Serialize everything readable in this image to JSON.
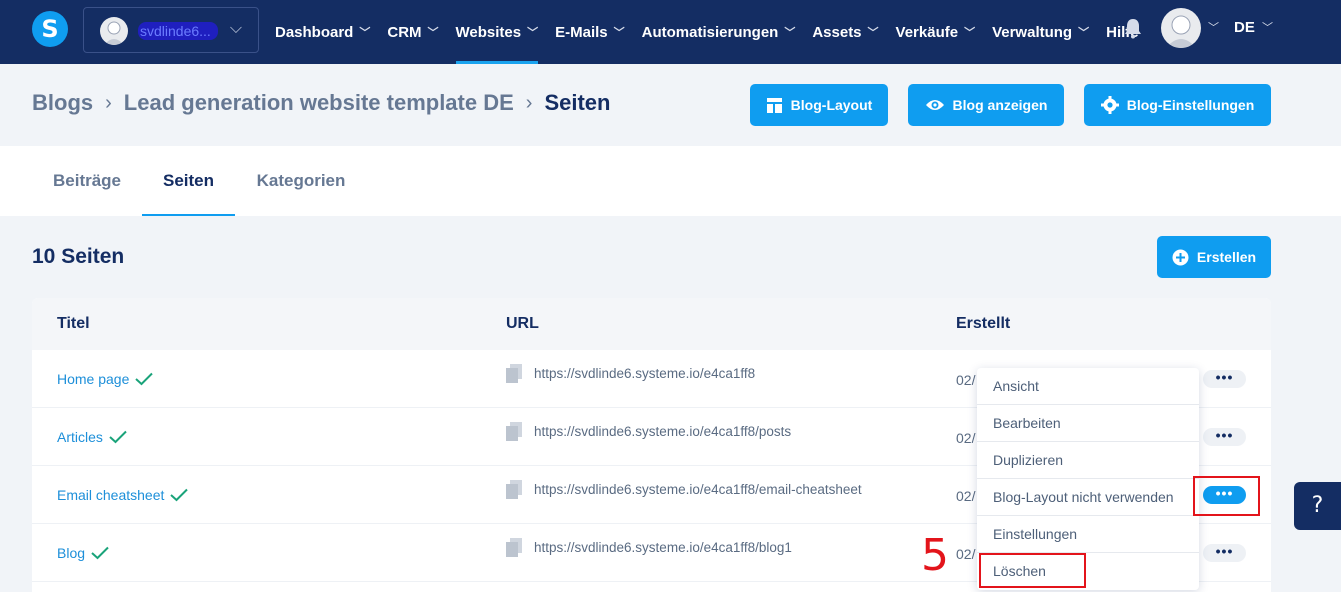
{
  "nav": {
    "logo": "S",
    "account_name": "svdlinde6...",
    "items": [
      {
        "label": "Dashboard"
      },
      {
        "label": "CRM"
      },
      {
        "label": "Websites"
      },
      {
        "label": "E-Mails"
      },
      {
        "label": "Automatisierungen"
      },
      {
        "label": "Assets"
      },
      {
        "label": "Verkäufe"
      },
      {
        "label": "Verwaltung"
      }
    ],
    "help_label": "Hilfe",
    "language": "DE",
    "active_item": "Websites"
  },
  "breadcrumb": {
    "root": "Blogs",
    "parent": "Lead generation website template DE",
    "current": "Seiten",
    "separator": "›"
  },
  "header_buttons": {
    "layout": "Blog-Layout",
    "view": "Blog anzeigen",
    "settings": "Blog-Einstellungen"
  },
  "tabs": [
    {
      "label": "Beiträge"
    },
    {
      "label": "Seiten"
    },
    {
      "label": "Kategorien"
    }
  ],
  "active_tab": "Seiten",
  "page_count": "10 Seiten",
  "create_button": "Erstellen",
  "table": {
    "columns": {
      "title": "Titel",
      "url": "URL",
      "created": "Erstellt"
    },
    "rows": [
      {
        "title": "Home page",
        "url": "https://svdlinde6.systeme.io/e4ca1ff8",
        "created": "02/"
      },
      {
        "title": "Articles",
        "url": "https://svdlinde6.systeme.io/e4ca1ff8/posts",
        "created": "02/"
      },
      {
        "title": "Email cheatsheet",
        "url": "https://svdlinde6.systeme.io/e4ca1ff8/email-cheatsheet",
        "created": "02/"
      },
      {
        "title": "Blog",
        "url": "https://svdlinde6.systeme.io/e4ca1ff8/blog1",
        "created": "02/"
      }
    ],
    "actions_label": "•••"
  },
  "dropdown": {
    "items": [
      {
        "label": "Ansicht"
      },
      {
        "label": "Bearbeiten"
      },
      {
        "label": "Duplizieren"
      },
      {
        "label": "Blog-Layout nicht verwenden"
      },
      {
        "label": "Einstellungen"
      },
      {
        "label": "Löschen"
      }
    ]
  },
  "annotation": {
    "step": "5"
  },
  "help_widget": "?",
  "colors": {
    "nav_bg": "#142d63",
    "accent": "#0f9df0",
    "highlight": "#e3141b",
    "check": "#1aa37a"
  }
}
